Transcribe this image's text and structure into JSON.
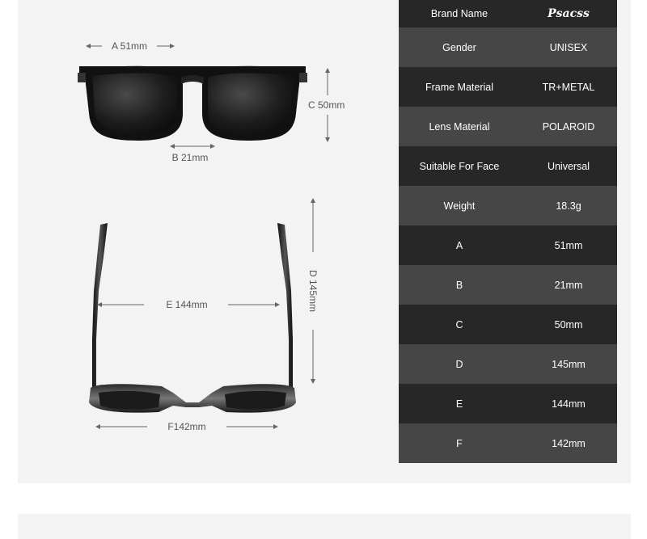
{
  "dimensions": {
    "a": "A 51mm",
    "b": "B 21mm",
    "c": "C 50mm",
    "d": "D 145mm",
    "e": "E 144mm",
    "f": "F142mm"
  },
  "specs": [
    {
      "key": "Brand Name",
      "value": "Psacss"
    },
    {
      "key": "Gender",
      "value": "UNISEX"
    },
    {
      "key": "Frame Material",
      "value": "TR+METAL"
    },
    {
      "key": "Lens Material",
      "value": "POLAROID"
    },
    {
      "key": "Suitable For Face",
      "value": "Universal"
    },
    {
      "key": "Weight",
      "value": "18.3g"
    },
    {
      "key": "A",
      "value": "51mm"
    },
    {
      "key": "B",
      "value": "21mm"
    },
    {
      "key": "C",
      "value": "50mm"
    },
    {
      "key": "D",
      "value": "145mm"
    },
    {
      "key": "E",
      "value": "144mm"
    },
    {
      "key": "F",
      "value": "142mm"
    }
  ]
}
